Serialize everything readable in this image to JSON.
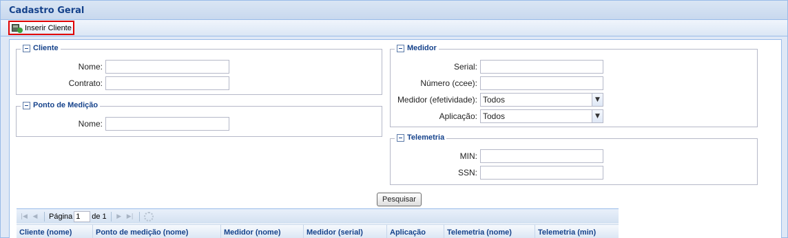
{
  "window": {
    "title": "Cadastro Geral"
  },
  "toolbar": {
    "insert_label": "Inserir Cliente"
  },
  "cliente": {
    "legend": "Cliente",
    "nome_label": "Nome:",
    "nome_value": "",
    "contrato_label": "Contrato:",
    "contrato_value": ""
  },
  "ponto": {
    "legend": "Ponto de Medição",
    "nome_label": "Nome:",
    "nome_value": ""
  },
  "medidor": {
    "legend": "Medidor",
    "serial_label": "Serial:",
    "serial_value": "",
    "numero_label": "Número (ccee):",
    "numero_value": "",
    "efetividade_label": "Medidor (efetividade):",
    "efetividade_value": "Todos",
    "aplicacao_label": "Aplicação:",
    "aplicacao_value": "Todos"
  },
  "telemetria": {
    "legend": "Telemetria",
    "min_label": "MIN:",
    "min_value": "",
    "ssn_label": "SSN:",
    "ssn_value": ""
  },
  "search": {
    "label": "Pesquisar"
  },
  "pager": {
    "page_label": "Página",
    "page_value": "1",
    "of_label": "de 1"
  },
  "grid": {
    "columns": [
      "Cliente (nome)",
      "Ponto de medição (nome)",
      "Medidor (nome)",
      "Medidor (serial)",
      "Aplicação",
      "Telemetria (nome)",
      "Telemetria (min)"
    ]
  }
}
